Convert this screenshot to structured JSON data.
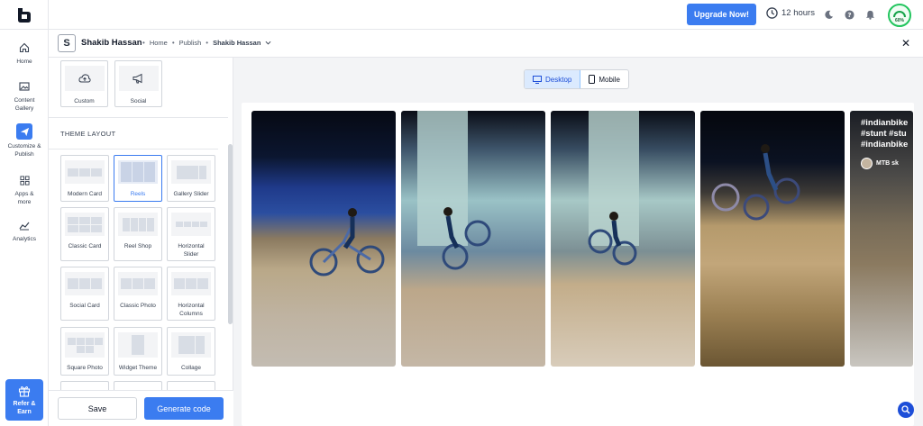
{
  "topbar": {
    "upgrade_label": "Upgrade Now!",
    "timer_label": "12 hours",
    "gauge_label": "60%",
    "gauge_value": 0.6,
    "icons": [
      "clock-icon",
      "moon-icon",
      "help-icon",
      "bell-icon"
    ]
  },
  "nav": {
    "items": [
      {
        "label": "Home",
        "icon": "home-icon"
      },
      {
        "label": "Content Gallery",
        "icon": "image-icon"
      },
      {
        "label": "Customize & Publish",
        "icon": "send-icon",
        "active": true
      },
      {
        "label": "Apps & more",
        "icon": "grid-icon"
      },
      {
        "label": "Analytics",
        "icon": "chart-icon"
      }
    ],
    "refer_label": "Refer & Earn"
  },
  "header": {
    "avatar_letter": "S",
    "account_name": "Shakib Hassan",
    "breadcrumbs": [
      "Home",
      "Publish"
    ],
    "current": "Shakib Hassan"
  },
  "panel": {
    "top_cards": [
      {
        "label": "Custom",
        "icon": "cloud-upload-icon"
      },
      {
        "label": "Social",
        "icon": "megaphone-icon"
      }
    ],
    "section_title": "THEME LAYOUT",
    "layouts": [
      {
        "label": "Modern Card"
      },
      {
        "label": "Reels",
        "selected": true
      },
      {
        "label": "Gallery Slider"
      },
      {
        "label": "Classic Card"
      },
      {
        "label": "Reel Shop"
      },
      {
        "label": "Horizontal Slider"
      },
      {
        "label": "Social Card"
      },
      {
        "label": "Classic Photo"
      },
      {
        "label": "Horizontal Columns"
      },
      {
        "label": "Square Photo"
      },
      {
        "label": "Widget Theme"
      },
      {
        "label": "Collage"
      }
    ],
    "save_label": "Save",
    "generate_label": "Generate code"
  },
  "preview": {
    "desktop_label": "Desktop",
    "mobile_label": "Mobile",
    "reel_overlay": [
      "#indianbike",
      "#stunt #stu",
      "#indianbike"
    ],
    "reel_author": "MTB sk"
  },
  "colors": {
    "accent": "#3b7cf0",
    "gauge": "#22c55e"
  }
}
